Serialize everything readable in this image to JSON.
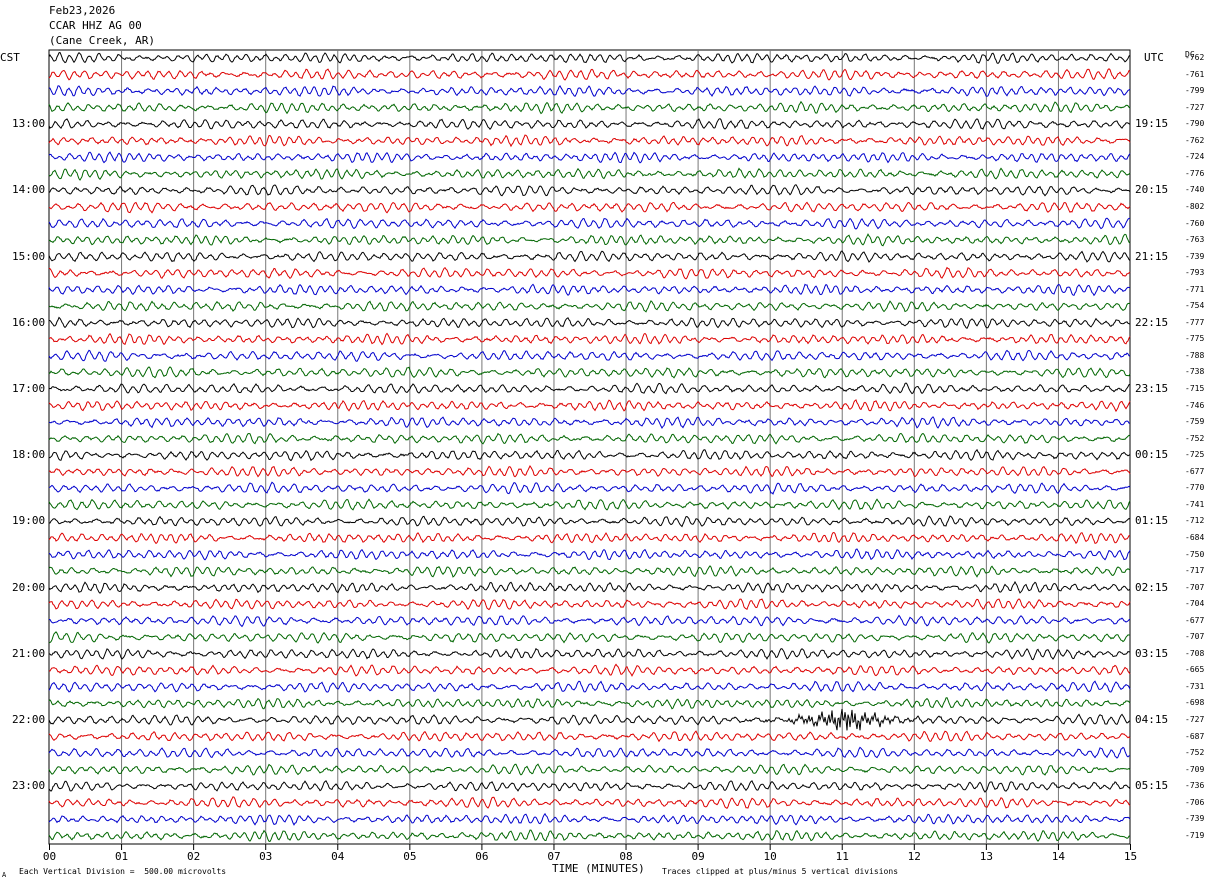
{
  "header": {
    "date": "Feb23,2026",
    "station": "CCAR HHZ AG 00",
    "location": "(Cane Creek, AR)"
  },
  "left_timezone": "CST",
  "right_timezone": "UTC",
  "dc_label": "DC",
  "footer": {
    "scale_note": "Each Vertical Division =  500.00 microvolts",
    "clip_note": "Traces clipped at plus/minus 5 vertical divisions",
    "corner_mark": "A"
  },
  "colors": {
    "trace_cycle": [
      "#000000",
      "#dd0000",
      "#0000cc",
      "#006600"
    ],
    "grid": "#777777",
    "frame": "#000000"
  },
  "chart_data": {
    "type": "line",
    "title": "",
    "xlabel": "TIME (MINUTES)",
    "ylabel": "",
    "xlim": [
      0,
      15
    ],
    "x_ticks": [
      "00",
      "01",
      "02",
      "03",
      "04",
      "05",
      "06",
      "07",
      "08",
      "09",
      "10",
      "11",
      "12",
      "13",
      "14",
      "15"
    ],
    "grid": true,
    "left_hour_labels": [
      "13:00",
      "14:00",
      "15:00",
      "16:00",
      "17:00",
      "18:00",
      "19:00",
      "20:00",
      "21:00",
      "22:00",
      "23:00"
    ],
    "right_hour_labels": [
      "19:15",
      "20:15",
      "21:15",
      "22:15",
      "23:15",
      "00:15",
      "01:15",
      "02:15",
      "03:15",
      "04:15",
      "05:15"
    ],
    "dc_offsets": [
      "-762",
      "-761",
      "-799",
      "-727",
      "-790",
      "-762",
      "-724",
      "-776",
      "-740",
      "-802",
      "-760",
      "-763",
      "-739",
      "-793",
      "-771",
      "-754",
      "-777",
      "-775",
      "-788",
      "-738",
      "-715",
      "-746",
      "-759",
      "-752",
      "-725",
      "-677",
      "-770",
      "-741",
      "-712",
      "-684",
      "-750",
      "-717",
      "-707",
      "-704",
      "-677",
      "-707",
      "-708",
      "-665",
      "-731",
      "-698",
      "-727",
      "-687",
      "-752",
      "-709",
      "-736",
      "-706",
      "-739",
      "-719"
    ],
    "event": {
      "trace_index": 40,
      "minute": 11.05,
      "peak_divisions": 4
    }
  }
}
